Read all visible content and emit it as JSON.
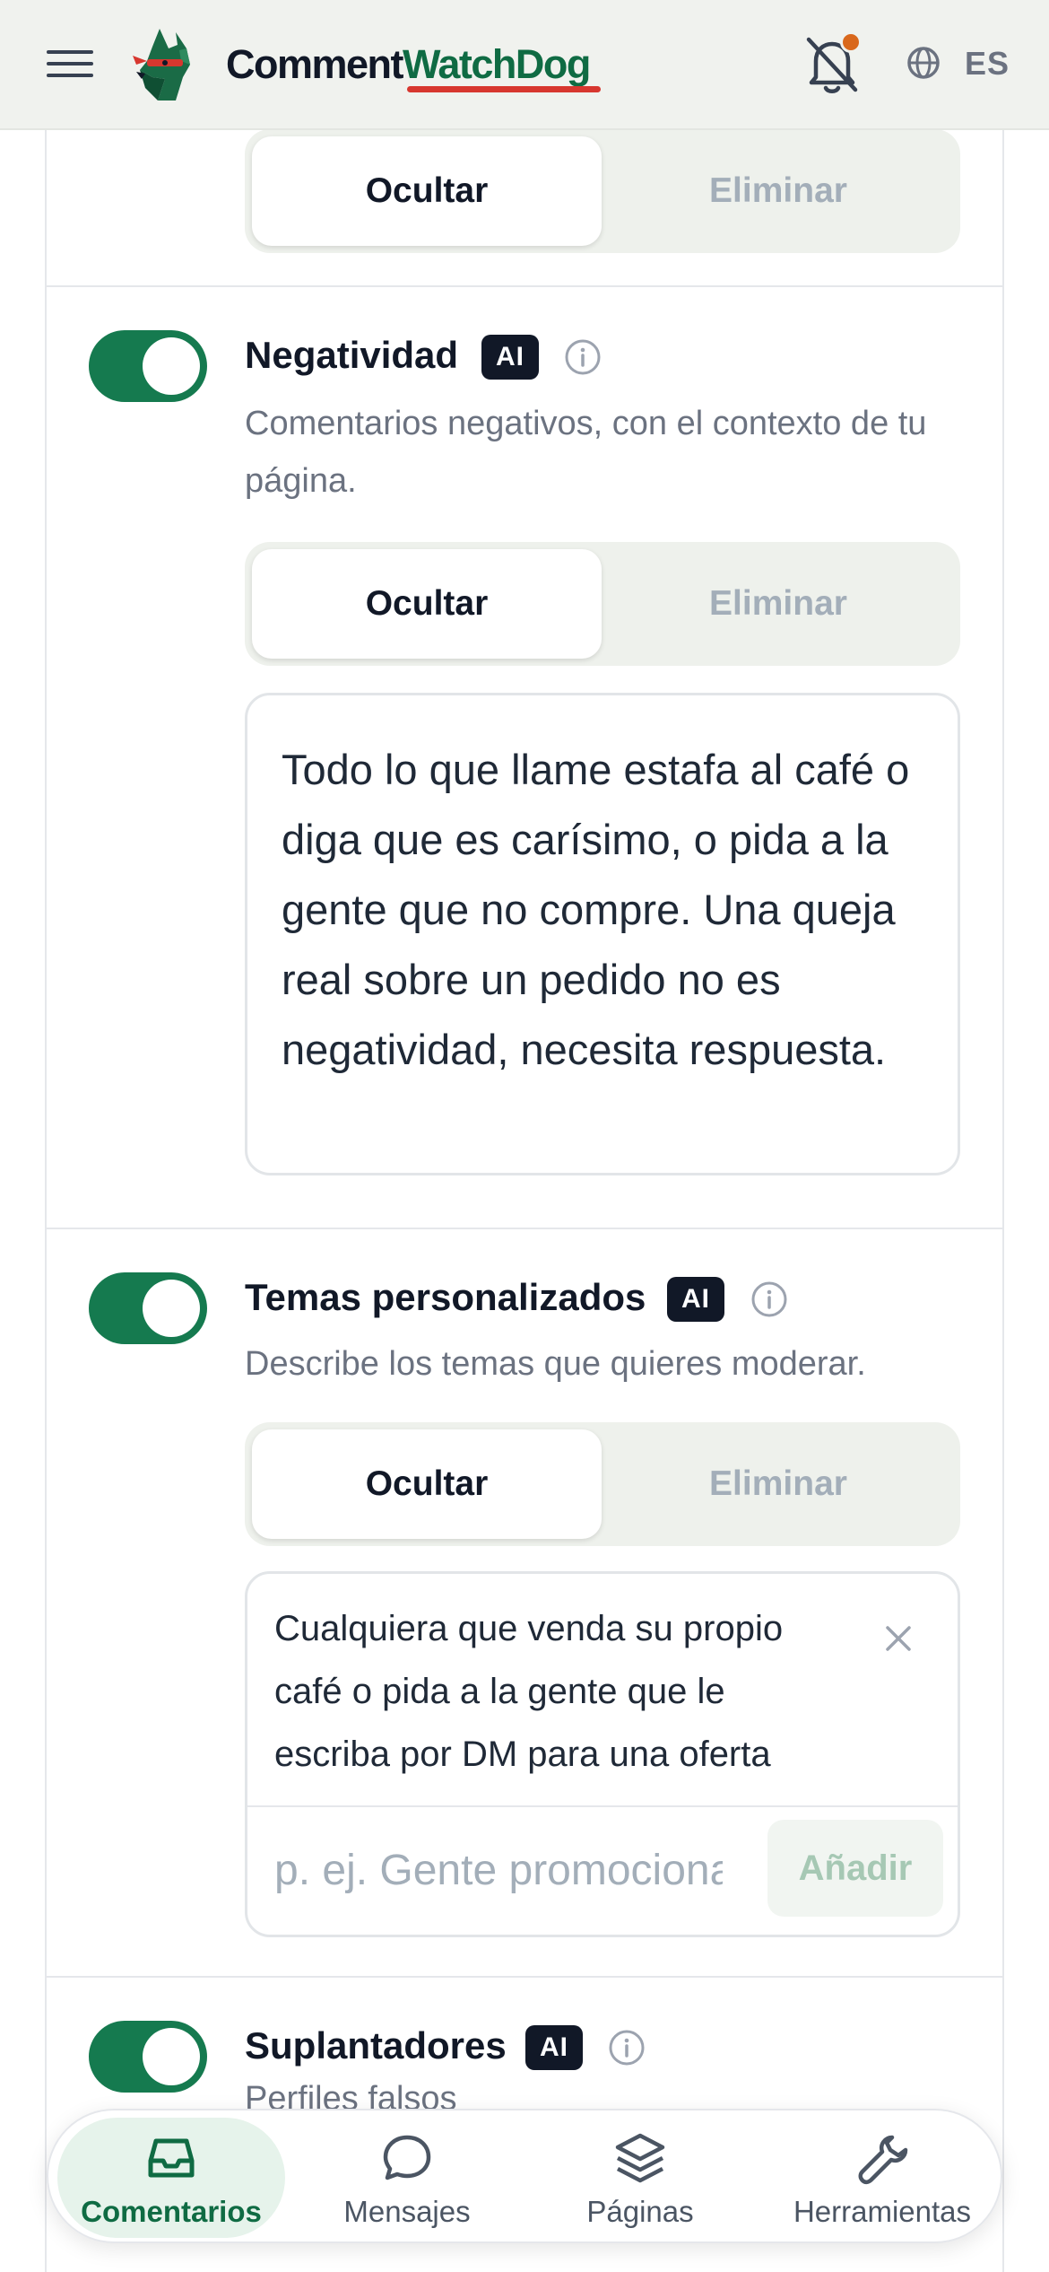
{
  "header": {
    "brand_part1": "Comment",
    "brand_part2": "WatchDog",
    "language": "ES"
  },
  "colors": {
    "brand_green": "#157a4f",
    "accent_red": "#d7372f",
    "notification_dot": "#d9681c"
  },
  "top_rule": {
    "action_active": "Ocultar",
    "action_inactive": "Eliminar"
  },
  "rules": [
    {
      "title": "Negatividad",
      "badge": "AI",
      "enabled": true,
      "description": "Comentarios negativos, con el contexto de tu página.",
      "action_active": "Ocultar",
      "action_inactive": "Eliminar",
      "context": "Todo lo que llame estafa al café o diga que es carísimo, o pida a la gente que no compre. Una queja real sobre un pedido no es negatividad, necesita respuesta."
    },
    {
      "title": "Temas personalizados",
      "badge": "AI",
      "enabled": true,
      "description": "Describe los temas que quieres moderar.",
      "action_active": "Ocultar",
      "action_inactive": "Eliminar",
      "topics": [
        "Cualquiera que venda su propio café o pida a la gente que le escriba por DM para una oferta"
      ],
      "input_placeholder": "p. ej. Gente promocionando",
      "add_label": "Añadir"
    },
    {
      "title": "Suplantadores",
      "badge": "AI",
      "enabled": true,
      "description": "Perfiles falsos"
    }
  ],
  "bottom_nav": [
    {
      "label": "Comentarios",
      "icon": "inbox-icon",
      "active": true
    },
    {
      "label": "Mensajes",
      "icon": "chat-bubble-icon",
      "active": false
    },
    {
      "label": "Páginas",
      "icon": "layers-icon",
      "active": false
    },
    {
      "label": "Herramientas",
      "icon": "wrench-icon",
      "active": false
    }
  ]
}
